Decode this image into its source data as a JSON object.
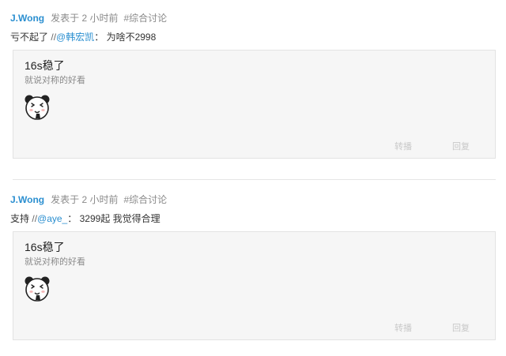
{
  "posts": [
    {
      "author": "J.Wong",
      "time": "发表于 2 小时前",
      "topic": "#综合讨论",
      "comment_text": "亏不起了",
      "separator": "//",
      "mention": "@韩宏凯",
      "colon": "：",
      "reply_text": "为啥不2998",
      "quote_title": "16s稳了",
      "quote_subtitle": "就说对称的好看",
      "quote_image_icon": "panda-face-icon",
      "action_forward": "转播",
      "action_reply": "回复"
    },
    {
      "author": "J.Wong",
      "time": "发表于 2 小时前",
      "topic": "#综合讨论",
      "comment_text": "支持",
      "separator": "//",
      "mention": "@aye_",
      "colon": "：",
      "reply_text": "3299起 我觉得合理",
      "quote_title": "16s稳了",
      "quote_subtitle": "就说对称的好看",
      "quote_image_icon": "panda-face-icon",
      "action_forward": "转播",
      "action_reply": "回复"
    }
  ],
  "colors": {
    "link": "#2b8fd0",
    "meta": "#8a8a8a",
    "quote_bg": "#f6f6f6",
    "action": "#c8c8c8"
  }
}
